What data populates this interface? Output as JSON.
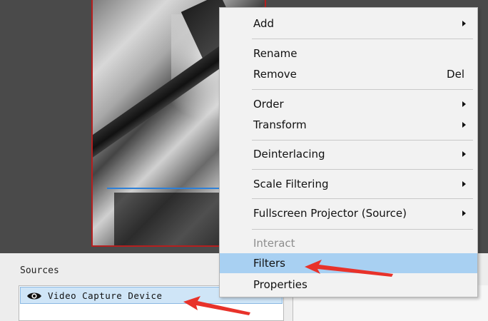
{
  "sources": {
    "title": "Sources",
    "items": [
      {
        "label": "Video Capture Device",
        "icon": "eye-icon",
        "visible": true,
        "selected": true
      }
    ]
  },
  "context_menu": {
    "items": [
      {
        "label": "Add",
        "submenu": true
      },
      {
        "label": "Rename"
      },
      {
        "label": "Remove",
        "shortcut": "Del"
      },
      {
        "label": "Order",
        "submenu": true
      },
      {
        "label": "Transform",
        "submenu": true
      },
      {
        "label": "Deinterlacing",
        "submenu": true
      },
      {
        "label": "Scale Filtering",
        "submenu": true
      },
      {
        "label": "Fullscreen Projector (Source)",
        "submenu": true
      },
      {
        "label": "Interact",
        "disabled": true
      },
      {
        "label": "Filters",
        "highlighted": true
      },
      {
        "label": "Properties"
      }
    ]
  },
  "colors": {
    "highlight": "#a8d0f2",
    "selection_border": "#b51f1f",
    "annotation_arrow": "#e8322a",
    "guide_line": "#2d80d8"
  }
}
